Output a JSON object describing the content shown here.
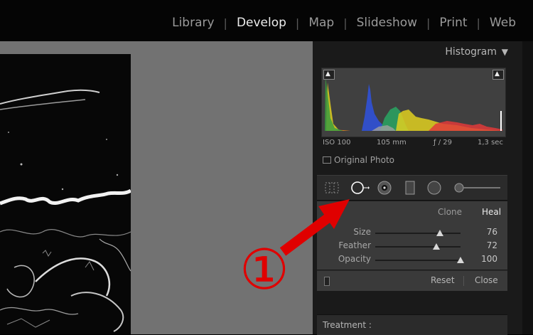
{
  "modules": [
    "Library",
    "Develop",
    "Map",
    "Slideshow",
    "Print",
    "Web"
  ],
  "active_module": "Develop",
  "histogram": {
    "title": "Histogram",
    "iso": "ISO 100",
    "focal": "105 mm",
    "aperture": "ƒ / 29",
    "shutter": "1,3 sec",
    "original_photo_label": "Original Photo"
  },
  "heal": {
    "clone_label": "Clone",
    "heal_label": "Heal",
    "sliders": [
      {
        "label": "Size",
        "value": "76",
        "level": 0.76
      },
      {
        "label": "Feather",
        "value": "72",
        "level": 0.72
      },
      {
        "label": "Opacity",
        "value": "100",
        "level": 1.0
      }
    ],
    "reset_label": "Reset",
    "close_label": "Close"
  },
  "treatment_label": "Treatment :",
  "annotation": {
    "number": "①",
    "color": "#e00000"
  }
}
